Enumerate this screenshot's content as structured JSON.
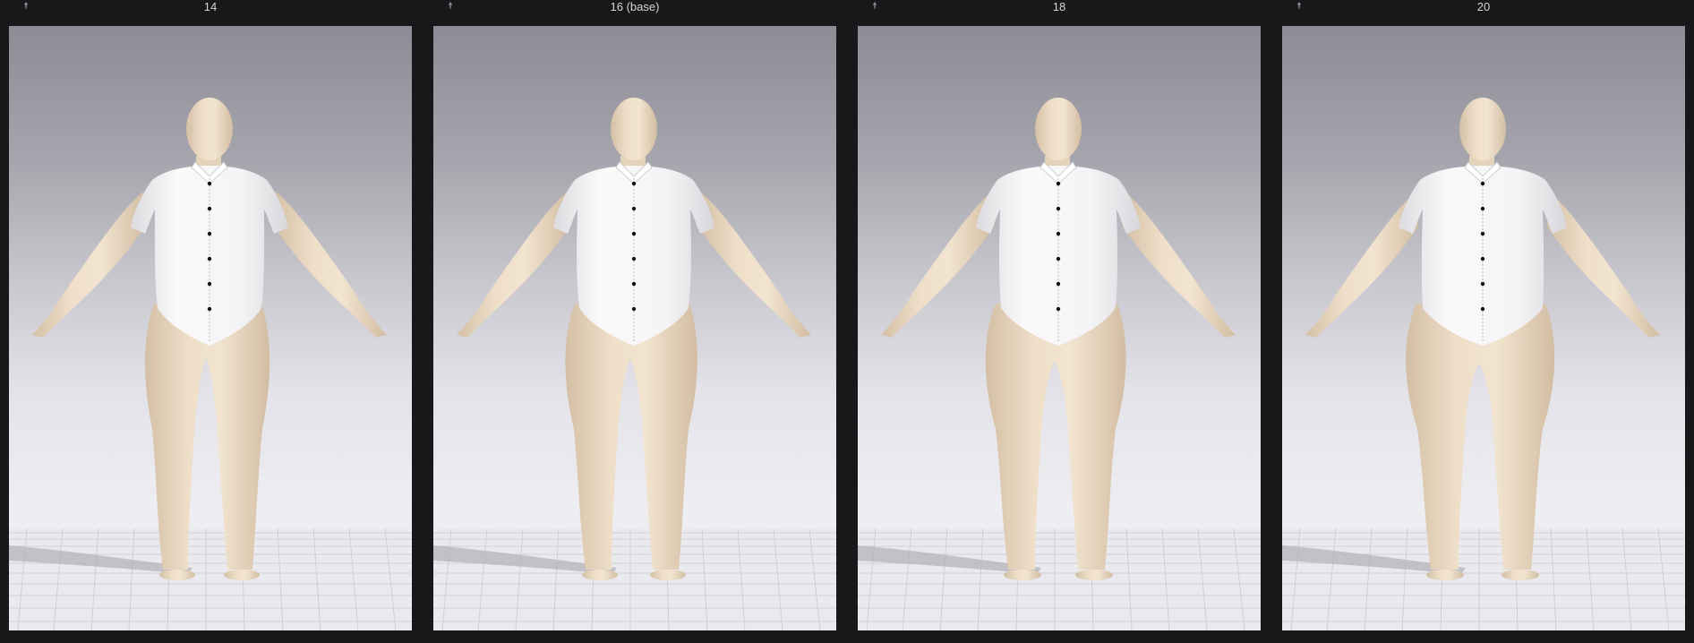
{
  "panels": [
    {
      "label": "14",
      "pin_icon": "pin-icon"
    },
    {
      "label": "16 (base)",
      "pin_icon": "pin-icon"
    },
    {
      "label": "18",
      "pin_icon": "pin-icon"
    },
    {
      "label": "20",
      "pin_icon": "pin-icon"
    }
  ],
  "colors": {
    "app_background": "#18181b",
    "label_text": "#d6d6d8",
    "viewport_top": "#8d8c95",
    "viewport_bottom": "#f1f1f4",
    "skin": "#ecdcc6",
    "shirt": "#f6f6f7",
    "buttons": "#111111"
  }
}
